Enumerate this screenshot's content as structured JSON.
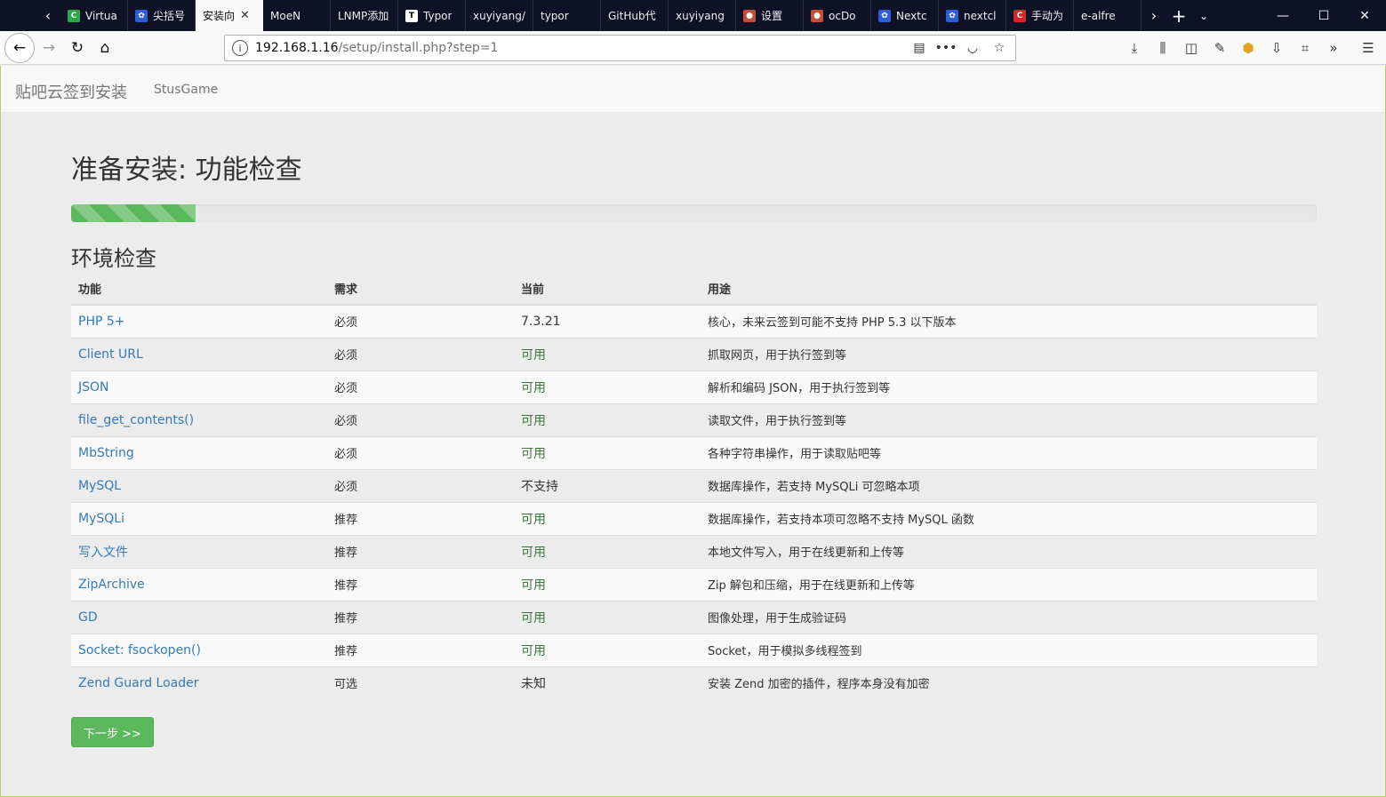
{
  "browser": {
    "tabs": [
      {
        "label": "Virtua",
        "fav": "C",
        "color": "#2ea84a"
      },
      {
        "label": "尖括号",
        "fav": "✿",
        "color": "#2c5fd6"
      },
      {
        "label": "安装向",
        "fav": "",
        "color": "",
        "active": true
      },
      {
        "label": "MoeN",
        "fav": "",
        "color": ""
      },
      {
        "label": "LNMP添加",
        "fav": "",
        "color": ""
      },
      {
        "label": "Typor",
        "fav": "T",
        "color": "#ffffff"
      },
      {
        "label": "xuyiyang/",
        "fav": "",
        "color": ""
      },
      {
        "label": "typor",
        "fav": "",
        "color": ""
      },
      {
        "label": "GitHub代",
        "fav": "",
        "color": ""
      },
      {
        "label": "xuyiyang",
        "fav": "",
        "color": ""
      },
      {
        "label": "设置",
        "fav": "●",
        "color": "#c0503c"
      },
      {
        "label": "ocDo",
        "fav": "●",
        "color": "#c0503c"
      },
      {
        "label": "Nextc",
        "fav": "✿",
        "color": "#2c5fd6"
      },
      {
        "label": "nextcl",
        "fav": "✿",
        "color": "#2c5fd6"
      },
      {
        "label": "手动为",
        "fav": "C",
        "color": "#d9252a"
      },
      {
        "label": "e-alfre",
        "fav": "",
        "color": ""
      }
    ],
    "address": {
      "host": "192.168.1.16",
      "path": "/setup/install.php?step=1"
    }
  },
  "site": {
    "brand": "贴吧云签到安装",
    "nav_link": "StusGame"
  },
  "main": {
    "title": "准备安装: 功能检查",
    "progress_percent": 10,
    "section_title": "环境检查",
    "columns": [
      "功能",
      "需求",
      "当前",
      "用途"
    ],
    "rows": [
      {
        "feature": "PHP 5+",
        "requirement": "必须",
        "current": "7.3.21",
        "status": "neutral",
        "purpose": "核心，未来云签到可能不支持 PHP 5.3 以下版本"
      },
      {
        "feature": "Client URL",
        "requirement": "必须",
        "current": "可用",
        "status": "ok",
        "purpose": "抓取网页，用于执行签到等"
      },
      {
        "feature": "JSON",
        "requirement": "必须",
        "current": "可用",
        "status": "ok",
        "purpose": "解析和编码 JSON，用于执行签到等"
      },
      {
        "feature": "file_get_contents()",
        "requirement": "必须",
        "current": "可用",
        "status": "ok",
        "purpose": "读取文件，用于执行签到等"
      },
      {
        "feature": "MbString",
        "requirement": "必须",
        "current": "可用",
        "status": "ok",
        "purpose": "各种字符串操作，用于读取贴吧等"
      },
      {
        "feature": "MySQL",
        "requirement": "必须",
        "current": "不支持",
        "status": "neutral",
        "purpose": "数据库操作，若支持 MySQLi 可忽略本项"
      },
      {
        "feature": "MySQLi",
        "requirement": "推荐",
        "current": "可用",
        "status": "ok",
        "purpose": "数据库操作，若支持本项可忽略不支持 MySQL 函数"
      },
      {
        "feature": "写入文件",
        "requirement": "推荐",
        "current": "可用",
        "status": "ok",
        "purpose": "本地文件写入，用于在线更新和上传等"
      },
      {
        "feature": "ZipArchive",
        "requirement": "推荐",
        "current": "可用",
        "status": "ok",
        "purpose": "Zip 解包和压缩，用于在线更新和上传等"
      },
      {
        "feature": "GD",
        "requirement": "推荐",
        "current": "可用",
        "status": "ok",
        "purpose": "图像处理，用于生成验证码"
      },
      {
        "feature": "Socket: fsockopen()",
        "requirement": "推荐",
        "current": "可用",
        "status": "ok",
        "purpose": "Socket，用于模拟多线程签到"
      },
      {
        "feature": "Zend Guard Loader",
        "requirement": "可选",
        "current": "未知",
        "status": "neutral",
        "purpose": "安装 Zend 加密的插件，程序本身没有加密"
      }
    ],
    "next_button": "下一步 >>"
  }
}
